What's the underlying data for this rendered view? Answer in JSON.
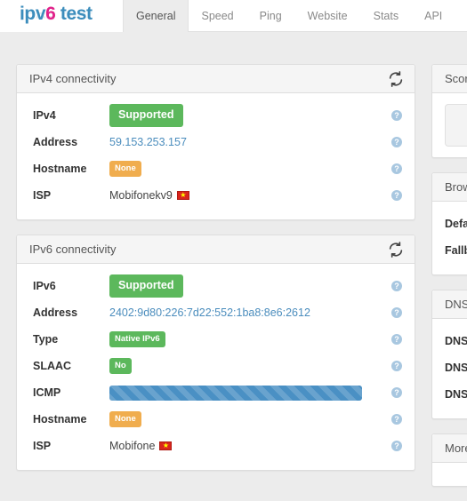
{
  "brand": {
    "prefix": "ipv",
    "six": "6",
    "suffix": " test"
  },
  "nav": {
    "tabs": [
      {
        "label": "General",
        "active": true
      },
      {
        "label": "Speed",
        "active": false
      },
      {
        "label": "Ping",
        "active": false
      },
      {
        "label": "Website",
        "active": false
      },
      {
        "label": "Stats",
        "active": false
      },
      {
        "label": "API",
        "active": false
      }
    ]
  },
  "icons": {
    "refresh": "refresh-icon",
    "help": "?"
  },
  "colors": {
    "brand_blue": "#3c8dbc",
    "brand_pink": "#e0218a",
    "success_green": "#5cb85c",
    "warning_orange": "#f0ad4e",
    "link_blue": "#4b8dbd",
    "progress_blue": "#4a90c4",
    "page_background": "#ececec"
  },
  "ipv4_panel": {
    "title": "IPv4 connectivity",
    "rows": [
      {
        "label": "IPv4",
        "type": "badge",
        "value": "Supported",
        "badge_color": "green",
        "size": "lg"
      },
      {
        "label": "Address",
        "type": "link",
        "value": "59.153.253.157"
      },
      {
        "label": "Hostname",
        "type": "badge",
        "value": "None",
        "badge_color": "orange",
        "size": "sm"
      },
      {
        "label": "ISP",
        "type": "text-flag",
        "value": "Mobifonekv9",
        "flag": "vietnam-flag"
      }
    ]
  },
  "ipv6_panel": {
    "title": "IPv6 connectivity",
    "rows": [
      {
        "label": "IPv6",
        "type": "badge",
        "value": "Supported",
        "badge_color": "green",
        "size": "lg"
      },
      {
        "label": "Address",
        "type": "link",
        "value": "2402:9d80:226:7d22:552:1ba8:8e6:2612"
      },
      {
        "label": "Type",
        "type": "badge",
        "value": "Native IPv6",
        "badge_color": "green",
        "size": "sm"
      },
      {
        "label": "SLAAC",
        "type": "badge",
        "value": "No",
        "badge_color": "green",
        "size": "sm"
      },
      {
        "label": "ICMP",
        "type": "progress",
        "value": ""
      },
      {
        "label": "Hostname",
        "type": "badge",
        "value": "None",
        "badge_color": "orange",
        "size": "sm"
      },
      {
        "label": "ISP",
        "type": "text-flag",
        "value": "Mobifone",
        "flag": "vietnam-flag"
      }
    ]
  },
  "sidebar": {
    "score_panel": {
      "title": "Score"
    },
    "browser_panel": {
      "title": "Browser",
      "rows": [
        {
          "label": "Default"
        },
        {
          "label": "Fallback"
        }
      ]
    },
    "dns_panel": {
      "title": "DNS",
      "rows": [
        {
          "label": "DNS"
        },
        {
          "label": "DNS"
        },
        {
          "label": "DNS"
        }
      ]
    },
    "more_panel": {
      "title": "More"
    }
  }
}
